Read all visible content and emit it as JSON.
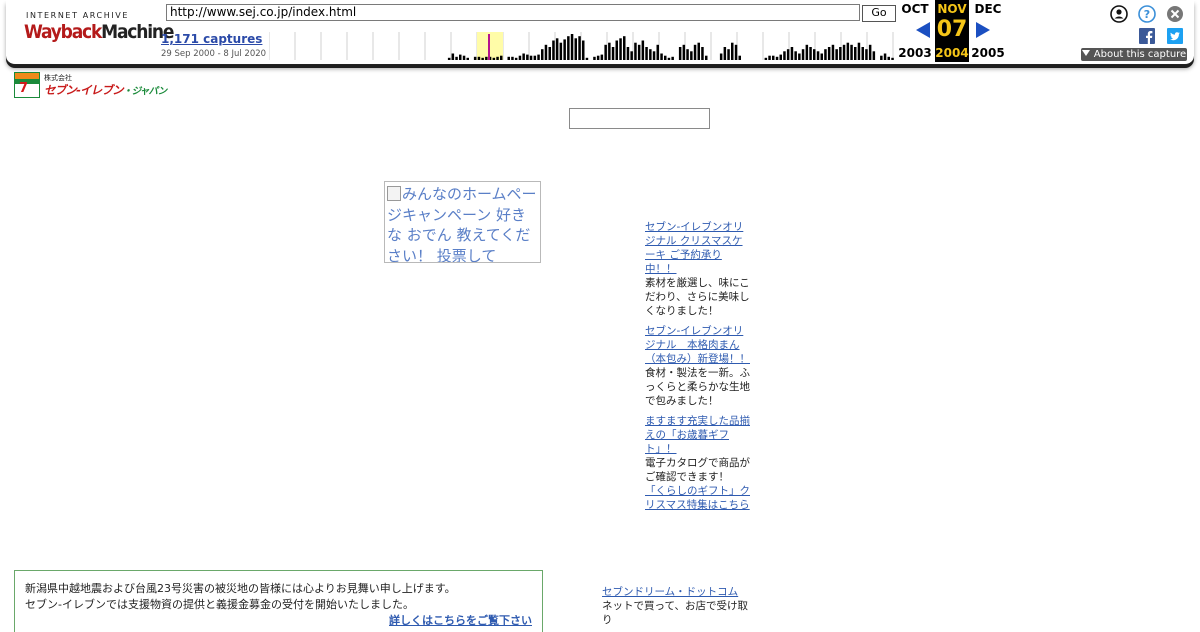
{
  "toolbar": {
    "logo_top": "INTERNET ARCHIVE",
    "logo_main_1": "Wayback",
    "logo_main_2": "Machine",
    "url": "http://www.sej.co.jp/index.html",
    "go_label": "Go",
    "captures_label": "1,171 captures",
    "capture_dates": "29 Sep 2000 - 8 Jul 2020",
    "prev": {
      "month": "OCT",
      "year": "2003"
    },
    "current": {
      "month": "NOV",
      "day": "07",
      "year": "2004"
    },
    "next": {
      "month": "DEC",
      "year": "2005"
    },
    "about_label": "About this capture",
    "icons": [
      "account-icon",
      "help-icon",
      "close-icon",
      "facebook-icon",
      "twitter-icon"
    ],
    "sparkline_bars": [
      0,
      0,
      0,
      0,
      0,
      0,
      0,
      0,
      0,
      0,
      0,
      0,
      0,
      0,
      0,
      0,
      0,
      0,
      0,
      0,
      0,
      0,
      0,
      0,
      0,
      0,
      0,
      0,
      0,
      0,
      0,
      0,
      0,
      0,
      0,
      0,
      0,
      0,
      0,
      0,
      0,
      0,
      0,
      0,
      0,
      0,
      0,
      0,
      2,
      6,
      3,
      5,
      4,
      2,
      0,
      3,
      3,
      2,
      3,
      3,
      2,
      3,
      4,
      0,
      3,
      3,
      2,
      4,
      6,
      5,
      4,
      4,
      5,
      10,
      14,
      12,
      18,
      20,
      16,
      19,
      22,
      24,
      20,
      22,
      18,
      2,
      0,
      3,
      4,
      5,
      14,
      16,
      12,
      18,
      20,
      22,
      12,
      8,
      16,
      14,
      18,
      12,
      10,
      8,
      14,
      6,
      4,
      2,
      3,
      0,
      12,
      14,
      10,
      8,
      14,
      16,
      12,
      4,
      0,
      0,
      0,
      6,
      12,
      10,
      16,
      14,
      4,
      0,
      0,
      0,
      0,
      0,
      0,
      2,
      4,
      4,
      3,
      5,
      8,
      10,
      12,
      8,
      6,
      10,
      14,
      12,
      10,
      8,
      6,
      10,
      12,
      14,
      10,
      12,
      14,
      16,
      14,
      12,
      16,
      12,
      10,
      14,
      8,
      0,
      4,
      6,
      3,
      2
    ],
    "colors": {
      "arrow": "#1b4fc1",
      "highlight": "#f5c518",
      "bars": "#000000",
      "selected_bar": "#b5138f",
      "year_band": "#fffca8"
    }
  },
  "page": {
    "logo_small": "株式会社",
    "logo_name": "セブン-イレブン",
    "logo_suffix": "・ジャパン",
    "campaign_alt": "みんなのホームページキャンペーン 好きな おでん 教えてください！ 投票して",
    "news": [
      {
        "link": "セブン-イレブンオリジナル クリスマスケーキ ご予約承り中！！",
        "text": "素材を厳選し、味にこだわり、さらに美味しくなりました！"
      },
      {
        "link": "セブン-イレブンオリジナル　本格肉まん（本包み）新登場！！",
        "text": "食材・製法を一新。ふっくらと柔らかな生地で包みました！"
      },
      {
        "link": "ますます充実した品揃えの「お歳暮ギフト」！",
        "text": "電子カタログで商品がご確認できます！"
      },
      {
        "link": "「くらしのギフト」クリスマス特集はこちら",
        "text": ""
      }
    ],
    "notice": {
      "line1": "新潟県中越地震および台風23号災害の被災地の皆様には心よりお見舞い申し上げます。",
      "line2": "セブン-イレブンでは支援物資の提供と義援金募金の受付を開始いたしました。",
      "more": "詳しくはこちらをご覧下さい"
    },
    "seven_dream": {
      "link": "セブンドリーム・ドットコム",
      "text": "ネットで買って、お店で受け取り"
    }
  }
}
